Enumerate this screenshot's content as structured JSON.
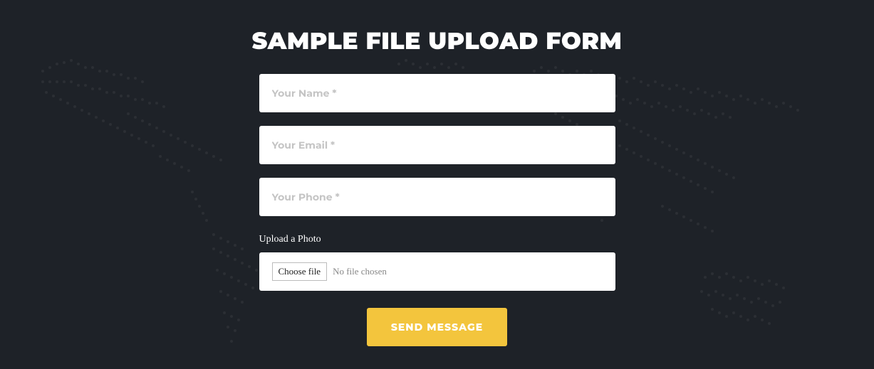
{
  "title": "SAMPLE FILE UPLOAD FORM",
  "fields": {
    "name_placeholder": "Your Name *",
    "email_placeholder": "Your Email *",
    "phone_placeholder": "Your Phone *"
  },
  "upload": {
    "label": "Upload a Photo",
    "choose_label": "Choose file",
    "no_file_text": "No file chosen"
  },
  "submit_label": "SEND MESSAGE"
}
